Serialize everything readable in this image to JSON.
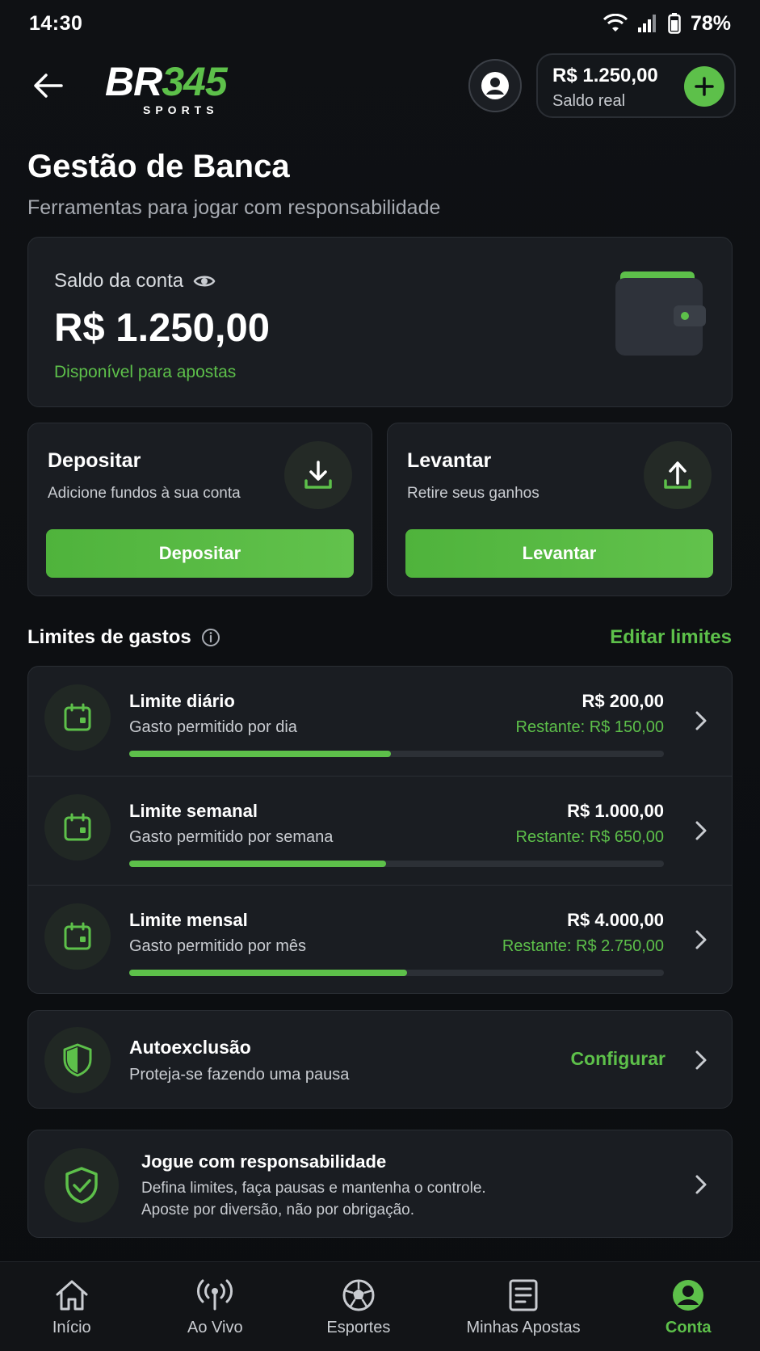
{
  "status_bar": {
    "time": "14:30",
    "battery": "78%"
  },
  "header": {
    "logo_part1": "BR",
    "logo_part2": "345",
    "logo_sub": "SPORTS",
    "balance_amount": "R$ 1.250,00",
    "balance_label": "Saldo real"
  },
  "page": {
    "title": "Gestão de Banca",
    "subtitle": "Ferramentas para jogar com responsabilidade"
  },
  "account": {
    "label": "Saldo da conta",
    "amount": "R$ 1.250,00",
    "available": "Disponível para apostas"
  },
  "deposit": {
    "title": "Depositar",
    "description": "Adicione fundos à sua conta",
    "button": "Depositar"
  },
  "withdraw": {
    "title": "Levantar",
    "description": "Retire seus ganhos",
    "button": "Levantar"
  },
  "limits": {
    "heading": "Limites de gastos",
    "edit": "Editar limites",
    "items": [
      {
        "title": "Limite diário",
        "description": "Gasto permitido por dia",
        "amount": "R$ 200,00",
        "remaining": "Restante: R$ 150,00",
        "progress": 0.49
      },
      {
        "title": "Limite semanal",
        "description": "Gasto permitido por semana",
        "amount": "R$ 1.000,00",
        "remaining": "Restante: R$ 650,00",
        "progress": 0.48
      },
      {
        "title": "Limite mensal",
        "description": "Gasto permitido por mês",
        "amount": "R$ 4.000,00",
        "remaining": "Restante: R$ 2.750,00",
        "progress": 0.52
      }
    ]
  },
  "self_exclusion": {
    "title": "Autoexclusão",
    "description": "Proteja-se fazendo uma pausa",
    "action": "Configurar"
  },
  "responsible": {
    "title": "Jogue com responsabilidade",
    "line1": "Defina limites, faça pausas e mantenha o controle.",
    "line2": "Aposte por diversão, não por obrigação."
  },
  "nav": {
    "items": [
      {
        "label": "Início",
        "icon": "home-icon"
      },
      {
        "label": "Ao Vivo",
        "icon": "live-icon"
      },
      {
        "label": "Esportes",
        "icon": "soccer-ball-icon"
      },
      {
        "label": "Minhas Apostas",
        "icon": "bets-icon"
      },
      {
        "label": "Conta",
        "icon": "account-icon"
      }
    ],
    "active": "Conta"
  },
  "colors": {
    "accent": "#5dc04a",
    "background": "#0d0f12",
    "card": "#1a1d22"
  }
}
